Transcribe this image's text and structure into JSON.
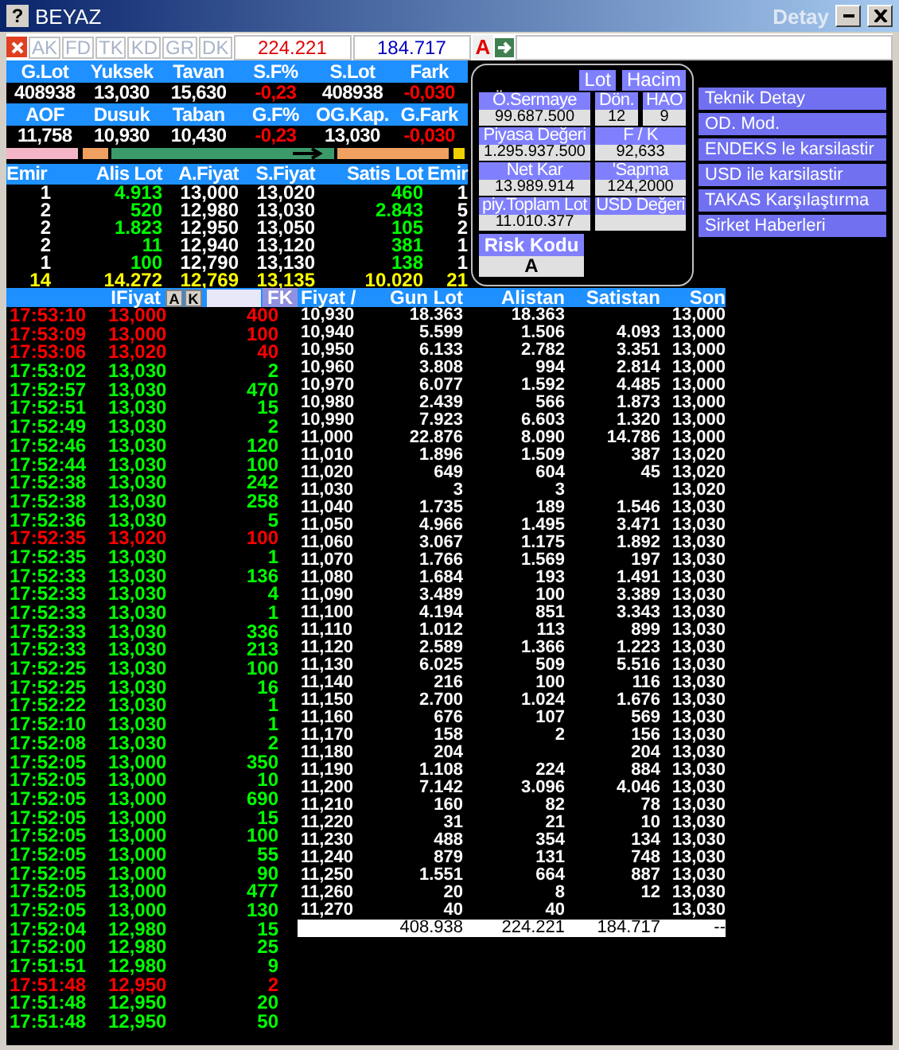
{
  "window": {
    "help": "?",
    "title": "BEYAZ",
    "subtitle": "Detay"
  },
  "toolbar": {
    "tabs": [
      {
        "label": "AK",
        "disabled": true
      },
      {
        "label": "FD",
        "disabled": true
      },
      {
        "label": "TK",
        "disabled": true
      },
      {
        "label": "KD",
        "disabled": true
      },
      {
        "label": "GR",
        "disabled": true
      },
      {
        "label": "DK",
        "disabled": true
      }
    ],
    "buy_total": "224.221",
    "sell_total": "184.717",
    "button": "A"
  },
  "summary": [
    [
      {
        "label": "G.Lot",
        "value": "408938",
        "negative": false
      },
      {
        "label": "Yuksek",
        "value": "13,030",
        "negative": false
      },
      {
        "label": "Tavan",
        "value": "15,630",
        "negative": false
      },
      {
        "label": "S.F%",
        "value": "-0,23",
        "negative": true
      },
      {
        "label": "S.Lot",
        "value": "408938",
        "negative": false
      },
      {
        "label": "Fark",
        "value": "-0,030",
        "negative": true
      }
    ],
    [
      {
        "label": "AOF",
        "value": "11,758",
        "negative": false
      },
      {
        "label": "Dusuk",
        "value": "10,930",
        "negative": false
      },
      {
        "label": "Taban",
        "value": "10,430",
        "negative": false
      },
      {
        "label": "G.F%",
        "value": "-0,23",
        "negative": true
      },
      {
        "label": "OG.Kap.",
        "value": "13,030",
        "negative": false
      },
      {
        "label": "G.Fark",
        "value": "-0,030",
        "negative": true
      }
    ]
  ],
  "order_book": {
    "columns": [
      "Emir",
      "Alis Lot",
      "A.Fiyat",
      "S.Fiyat",
      "Satis Lot",
      "Emir"
    ],
    "rows": [
      [
        "1",
        "4.913",
        "13,000",
        "13,020",
        "460",
        "1"
      ],
      [
        "2",
        "520",
        "12,980",
        "13,030",
        "2.843",
        "5"
      ],
      [
        "2",
        "1.823",
        "12,950",
        "13,050",
        "105",
        "2"
      ],
      [
        "2",
        "11",
        "12,940",
        "13,120",
        "381",
        "1"
      ],
      [
        "1",
        "100",
        "12,790",
        "13,130",
        "138",
        "1"
      ]
    ],
    "totals": [
      "14",
      "14.272",
      "12,769",
      "13,135",
      "10.020",
      "21"
    ]
  },
  "detail": {
    "buttons": [
      "Lot",
      "Hacim"
    ],
    "stat_rows": [
      [
        {
          "label": "Ö.Sermaye",
          "value": "99.687.500"
        },
        {
          "label": "Dön.",
          "value": "12"
        },
        {
          "label": "HAO",
          "value": "9"
        }
      ],
      [
        {
          "label": "Piyasa Değeri",
          "value": "1.295.937.500"
        },
        {
          "label": "F / K",
          "value": "92,633"
        }
      ],
      [
        {
          "label": "Net Kar",
          "value": "13.989.914"
        },
        {
          "label": "'Sapma",
          "value": "124,2000"
        }
      ],
      [
        {
          "label": "piy.Toplam Lot",
          "value": "11.010.377"
        },
        {
          "label": "USD Değeri"
        }
      ]
    ],
    "risk": {
      "label": "Risk Kodu",
      "value": "A"
    }
  },
  "menu": [
    "Teknik Detay",
    "OD. Mod.",
    "ENDEKS le karsilastir",
    "USD ile karsilastir",
    "TAKAS Karşılaştırma",
    "Sirket Haberleri"
  ],
  "trades": {
    "label": "IFiyat",
    "buttons": [
      "A",
      "K"
    ],
    "filter_button": "FK",
    "rows": [
      {
        "time": "17:53:10",
        "price": "13,000",
        "lot": "400",
        "kind": "down"
      },
      {
        "time": "17:53:09",
        "price": "13,000",
        "lot": "100",
        "kind": "down"
      },
      {
        "time": "17:53:06",
        "price": "13,020",
        "lot": "40",
        "kind": "down"
      },
      {
        "time": "17:53:02",
        "price": "13,030",
        "lot": "2",
        "kind": "up"
      },
      {
        "time": "17:52:57",
        "price": "13,030",
        "lot": "470",
        "kind": "up"
      },
      {
        "time": "17:52:51",
        "price": "13,030",
        "lot": "15",
        "kind": "up"
      },
      {
        "time": "17:52:49",
        "price": "13,030",
        "lot": "2",
        "kind": "up"
      },
      {
        "time": "17:52:46",
        "price": "13,030",
        "lot": "120",
        "kind": "up"
      },
      {
        "time": "17:52:44",
        "price": "13,030",
        "lot": "100",
        "kind": "up"
      },
      {
        "time": "17:52:38",
        "price": "13,030",
        "lot": "242",
        "kind": "up"
      },
      {
        "time": "17:52:38",
        "price": "13,030",
        "lot": "258",
        "kind": "up"
      },
      {
        "time": "17:52:36",
        "price": "13,030",
        "lot": "5",
        "kind": "up"
      },
      {
        "time": "17:52:35",
        "price": "13,020",
        "lot": "100",
        "kind": "down"
      },
      {
        "time": "17:52:35",
        "price": "13,030",
        "lot": "1",
        "kind": "up"
      },
      {
        "time": "17:52:33",
        "price": "13,030",
        "lot": "136",
        "kind": "up"
      },
      {
        "time": "17:52:33",
        "price": "13,030",
        "lot": "4",
        "kind": "up"
      },
      {
        "time": "17:52:33",
        "price": "13,030",
        "lot": "1",
        "kind": "up"
      },
      {
        "time": "17:52:33",
        "price": "13,030",
        "lot": "336",
        "kind": "up"
      },
      {
        "time": "17:52:33",
        "price": "13,030",
        "lot": "213",
        "kind": "up"
      },
      {
        "time": "17:52:25",
        "price": "13,030",
        "lot": "100",
        "kind": "up"
      },
      {
        "time": "17:52:25",
        "price": "13,030",
        "lot": "16",
        "kind": "up"
      },
      {
        "time": "17:52:22",
        "price": "13,030",
        "lot": "1",
        "kind": "up"
      },
      {
        "time": "17:52:10",
        "price": "13,030",
        "lot": "1",
        "kind": "up"
      },
      {
        "time": "17:52:08",
        "price": "13,030",
        "lot": "2",
        "kind": "up"
      },
      {
        "time": "17:52:05",
        "price": "13,000",
        "lot": "350",
        "kind": "up"
      },
      {
        "time": "17:52:05",
        "price": "13,000",
        "lot": "10",
        "kind": "up"
      },
      {
        "time": "17:52:05",
        "price": "13,000",
        "lot": "690",
        "kind": "up"
      },
      {
        "time": "17:52:05",
        "price": "13,000",
        "lot": "15",
        "kind": "up"
      },
      {
        "time": "17:52:05",
        "price": "13,000",
        "lot": "100",
        "kind": "up"
      },
      {
        "time": "17:52:05",
        "price": "13,000",
        "lot": "55",
        "kind": "up"
      },
      {
        "time": "17:52:05",
        "price": "13,000",
        "lot": "90",
        "kind": "up"
      },
      {
        "time": "17:52:05",
        "price": "13,000",
        "lot": "477",
        "kind": "up"
      },
      {
        "time": "17:52:05",
        "price": "13,000",
        "lot": "130",
        "kind": "up"
      },
      {
        "time": "17:52:04",
        "price": "12,980",
        "lot": "15",
        "kind": "up"
      },
      {
        "time": "17:52:00",
        "price": "12,980",
        "lot": "25",
        "kind": "up"
      },
      {
        "time": "17:51:51",
        "price": "12,980",
        "lot": "9",
        "kind": "up"
      },
      {
        "time": "17:51:48",
        "price": "12,950",
        "lot": "2",
        "kind": "down"
      },
      {
        "time": "17:51:48",
        "price": "12,950",
        "lot": "20",
        "kind": "up"
      },
      {
        "time": "17:51:48",
        "price": "12,950",
        "lot": "50",
        "kind": "up"
      }
    ]
  },
  "price_table": {
    "columns": [
      "Fiyat /",
      "Gun Lot",
      "Alistan",
      "Satistan",
      "Son"
    ],
    "rows": [
      [
        "10,930",
        "18.363",
        "18.363",
        null,
        "13,000"
      ],
      [
        "10,940",
        "5.599",
        "1.506",
        "4.093",
        "13,000"
      ],
      [
        "10,950",
        "6.133",
        "2.782",
        "3.351",
        "13,000"
      ],
      [
        "10,960",
        "3.808",
        "994",
        "2.814",
        "13,000"
      ],
      [
        "10,970",
        "6.077",
        "1.592",
        "4.485",
        "13,000"
      ],
      [
        "10,980",
        "2.439",
        "566",
        "1.873",
        "13,000"
      ],
      [
        "10,990",
        "7.923",
        "6.603",
        "1.320",
        "13,000"
      ],
      [
        "11,000",
        "22.876",
        "8.090",
        "14.786",
        "13,000"
      ],
      [
        "11,010",
        "1.896",
        "1.509",
        "387",
        "13,020"
      ],
      [
        "11,020",
        "649",
        "604",
        "45",
        "13,020"
      ],
      [
        "11,030",
        "3",
        "3",
        null,
        "13,020"
      ],
      [
        "11,040",
        "1.735",
        "189",
        "1.546",
        "13,030"
      ],
      [
        "11,050",
        "4.966",
        "1.495",
        "3.471",
        "13,030"
      ],
      [
        "11,060",
        "3.067",
        "1.175",
        "1.892",
        "13,030"
      ],
      [
        "11,070",
        "1.766",
        "1.569",
        "197",
        "13,030"
      ],
      [
        "11,080",
        "1.684",
        "193",
        "1.491",
        "13,030"
      ],
      [
        "11,090",
        "3.489",
        "100",
        "3.389",
        "13,030"
      ],
      [
        "11,100",
        "4.194",
        "851",
        "3.343",
        "13,030"
      ],
      [
        "11,110",
        "1.012",
        "113",
        "899",
        "13,030"
      ],
      [
        "11,120",
        "2.589",
        "1.366",
        "1.223",
        "13,030"
      ],
      [
        "11,130",
        "6.025",
        "509",
        "5.516",
        "13,030"
      ],
      [
        "11,140",
        "216",
        "100",
        "116",
        "13,030"
      ],
      [
        "11,150",
        "2.700",
        "1.024",
        "1.676",
        "13,030"
      ],
      [
        "11,160",
        "676",
        "107",
        "569",
        "13,030"
      ],
      [
        "11,170",
        "158",
        "2",
        "156",
        "13,030"
      ],
      [
        "11,180",
        "204",
        null,
        "204",
        "13,030"
      ],
      [
        "11,190",
        "1.108",
        "224",
        "884",
        "13,030"
      ],
      [
        "11,200",
        "7.142",
        "3.096",
        "4.046",
        "13,030"
      ],
      [
        "11,210",
        "160",
        "82",
        "78",
        "13,030"
      ],
      [
        "11,220",
        "31",
        "21",
        "10",
        "13,030"
      ],
      [
        "11,230",
        "488",
        "354",
        "134",
        "13,030"
      ],
      [
        "11,240",
        "879",
        "131",
        "748",
        "13,030"
      ],
      [
        "11,250",
        "1.551",
        "664",
        "887",
        "13,030"
      ],
      [
        "11,260",
        "20",
        "8",
        "12",
        "13,030"
      ],
      [
        "11,270",
        "40",
        "40",
        null,
        "13,030"
      ]
    ],
    "totals": {
      "gun_lot": "408.938",
      "alistan": "224.221",
      "satistan": "184.717",
      "son": "--"
    }
  }
}
